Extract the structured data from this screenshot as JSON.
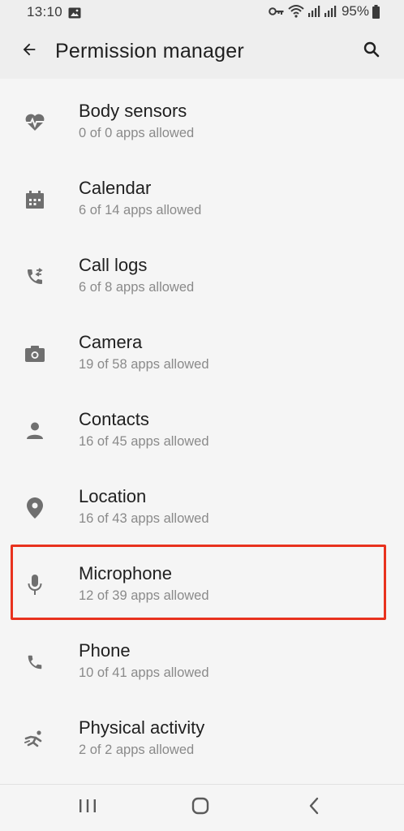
{
  "status_bar": {
    "time": "13:10",
    "battery_percent": "95%"
  },
  "app_bar": {
    "title": "Permission manager",
    "back_icon": "arrow-back-icon",
    "search_icon": "search-icon"
  },
  "permissions": [
    {
      "label": "Body sensors",
      "summary": "0 of 0 apps allowed",
      "icon": "heart-pulse-icon"
    },
    {
      "label": "Calendar",
      "summary": "6 of 14 apps allowed",
      "icon": "calendar-icon"
    },
    {
      "label": "Call logs",
      "summary": "6 of 8 apps allowed",
      "icon": "call-log-icon"
    },
    {
      "label": "Camera",
      "summary": "19 of 58 apps allowed",
      "icon": "camera-icon"
    },
    {
      "label": "Contacts",
      "summary": "16 of 45 apps allowed",
      "icon": "person-icon"
    },
    {
      "label": "Location",
      "summary": "16 of 43 apps allowed",
      "icon": "location-pin-icon"
    },
    {
      "label": "Microphone",
      "summary": "12 of 39 apps allowed",
      "icon": "microphone-icon"
    },
    {
      "label": "Phone",
      "summary": "10 of 41 apps allowed",
      "icon": "phone-icon"
    },
    {
      "label": "Physical activity",
      "summary": "2 of 2 apps allowed",
      "icon": "running-icon"
    }
  ],
  "highlighted_item": "Microphone",
  "colors": {
    "highlight": "#e8321e",
    "icon": "#6f6f6f",
    "background": "#f5f5f5",
    "bar": "#eeeeee"
  },
  "nav_bar": {
    "recents_icon": "recents-icon",
    "home_icon": "home-icon",
    "back_icon": "nav-back-icon"
  }
}
